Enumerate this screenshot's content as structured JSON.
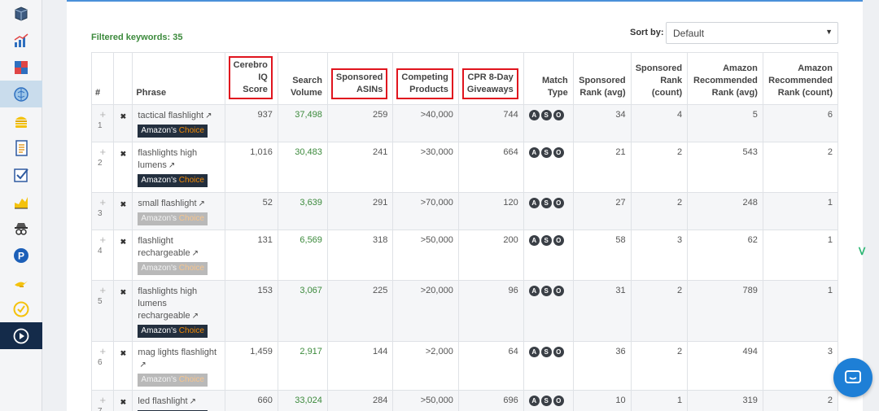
{
  "sidebar": {
    "items": [
      {
        "icon": "cube-search-icon"
      },
      {
        "icon": "bar-chart-icon"
      },
      {
        "icon": "puzzle-icon"
      },
      {
        "icon": "brain-icon",
        "active": true
      },
      {
        "icon": "burger-icon"
      },
      {
        "icon": "document-list-icon"
      },
      {
        "icon": "checkbox-icon"
      },
      {
        "icon": "area-chart-icon"
      },
      {
        "icon": "spy-icon"
      },
      {
        "icon": "parking-icon"
      },
      {
        "icon": "genie-lamp-icon"
      },
      {
        "icon": "check-badge-icon"
      },
      {
        "icon": "play-circle-icon",
        "dark": true
      }
    ]
  },
  "header": {
    "filtered_label": "Filtered keywords: 35",
    "sort_label": "Sort by:",
    "sort_value": "Default"
  },
  "columns": [
    {
      "key": "num",
      "label": "#"
    },
    {
      "key": "x",
      "label": ""
    },
    {
      "key": "phrase",
      "label": "Phrase"
    },
    {
      "key": "cerebro",
      "label": "Cerebro IQ Score",
      "lines": [
        "Cerebro",
        "IQ",
        "Score"
      ],
      "highlight": true
    },
    {
      "key": "search",
      "label": "Search Volume",
      "lines": [
        "Search",
        "Volume"
      ]
    },
    {
      "key": "sponsored_asins",
      "label": "Sponsored ASINs",
      "lines": [
        "Sponsored",
        "ASINs"
      ],
      "highlight": true
    },
    {
      "key": "competing",
      "label": "Competing Products",
      "lines": [
        "Competing",
        "Products"
      ],
      "highlight": true
    },
    {
      "key": "cpr",
      "label": "CPR 8-Day Giveaways",
      "lines": [
        "CPR 8-Day",
        "Giveaways"
      ],
      "highlight": true
    },
    {
      "key": "match",
      "label": "Match Type",
      "lines": [
        "Match",
        "Type"
      ]
    },
    {
      "key": "sp_rank_avg",
      "label": "Sponsored Rank (avg)",
      "lines": [
        "Sponsored",
        "Rank (avg)"
      ]
    },
    {
      "key": "sp_rank_count",
      "label": "Sponsored Rank (count)",
      "lines": [
        "Sponsored",
        "Rank",
        "(count)"
      ]
    },
    {
      "key": "amz_rank_avg",
      "label": "Amazon Recommended Rank (avg)",
      "lines": [
        "Amazon",
        "Recommended",
        "Rank (avg)"
      ]
    },
    {
      "key": "amz_rank_count",
      "label": "Amazon Recommended Rank (count)",
      "lines": [
        "Amazon",
        "Recommended",
        "Rank (count)"
      ]
    }
  ],
  "badge": {
    "amazon": "Amazon's",
    "choice": "Choice"
  },
  "ext_icon": "↗",
  "match_letters": [
    "A",
    "S",
    "O"
  ],
  "rows": [
    {
      "num": "1",
      "phrase": "tactical flashlight",
      "badge": "dark",
      "cerebro": "937",
      "search": "37,498",
      "sponsored_asins": "259",
      "competing": ">40,000",
      "cpr": "744",
      "sp_rank_avg": "34",
      "sp_rank_count": "4",
      "amz_rank_avg": "5",
      "amz_rank_count": "6"
    },
    {
      "num": "2",
      "phrase": "flashlights high lumens",
      "badge": "dark",
      "cerebro": "1,016",
      "search": "30,483",
      "sponsored_asins": "241",
      "competing": ">30,000",
      "cpr": "664",
      "sp_rank_avg": "21",
      "sp_rank_count": "2",
      "amz_rank_avg": "543",
      "amz_rank_count": "2"
    },
    {
      "num": "3",
      "phrase": "small flashlight",
      "badge": "gray",
      "cerebro": "52",
      "search": "3,639",
      "sponsored_asins": "291",
      "competing": ">70,000",
      "cpr": "120",
      "sp_rank_avg": "27",
      "sp_rank_count": "2",
      "amz_rank_avg": "248",
      "amz_rank_count": "1"
    },
    {
      "num": "4",
      "phrase": "flashlight rechargeable",
      "badge": "gray",
      "cerebro": "131",
      "search": "6,569",
      "sponsored_asins": "318",
      "competing": ">50,000",
      "cpr": "200",
      "sp_rank_avg": "58",
      "sp_rank_count": "3",
      "amz_rank_avg": "62",
      "amz_rank_count": "1"
    },
    {
      "num": "5",
      "phrase": "flashlights high lumens rechargeable",
      "badge": "dark",
      "cerebro": "153",
      "search": "3,067",
      "sponsored_asins": "225",
      "competing": ">20,000",
      "cpr": "96",
      "sp_rank_avg": "31",
      "sp_rank_count": "2",
      "amz_rank_avg": "789",
      "amz_rank_count": "1"
    },
    {
      "num": "6",
      "phrase": "mag lights flashlight",
      "badge": "gray",
      "cerebro": "1,459",
      "search": "2,917",
      "sponsored_asins": "144",
      "competing": ">2,000",
      "cpr": "64",
      "sp_rank_avg": "36",
      "sp_rank_count": "2",
      "amz_rank_avg": "494",
      "amz_rank_count": "3"
    },
    {
      "num": "7",
      "phrase": "led flashlight",
      "badge": "dark",
      "cerebro": "660",
      "search": "33,024",
      "sponsored_asins": "284",
      "competing": ">50,000",
      "cpr": "696",
      "sp_rank_avg": "10",
      "sp_rank_count": "1",
      "amz_rank_avg": "319",
      "amz_rank_count": "2"
    }
  ],
  "widgets": {
    "chat_icon": "chat-bubble-icon",
    "extension_icon": "extension-v-icon"
  }
}
